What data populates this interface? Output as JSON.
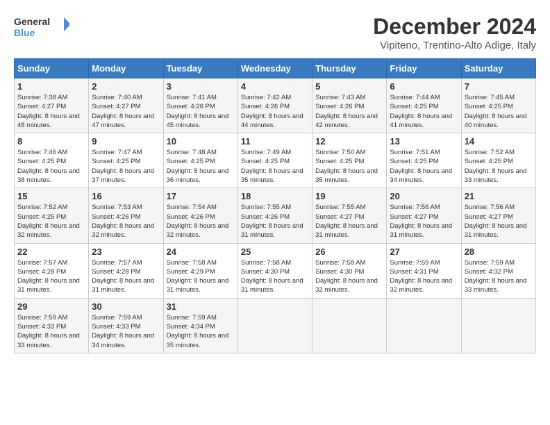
{
  "logo": {
    "line1": "General",
    "line2": "Blue"
  },
  "title": "December 2024",
  "location": "Vipiteno, Trentino-Alto Adige, Italy",
  "weekdays": [
    "Sunday",
    "Monday",
    "Tuesday",
    "Wednesday",
    "Thursday",
    "Friday",
    "Saturday"
  ],
  "weeks": [
    [
      {
        "day": "1",
        "sunrise": "7:38 AM",
        "sunset": "4:27 PM",
        "daylight": "8 hours and 48 minutes."
      },
      {
        "day": "2",
        "sunrise": "7:40 AM",
        "sunset": "4:27 PM",
        "daylight": "8 hours and 47 minutes."
      },
      {
        "day": "3",
        "sunrise": "7:41 AM",
        "sunset": "4:26 PM",
        "daylight": "8 hours and 45 minutes."
      },
      {
        "day": "4",
        "sunrise": "7:42 AM",
        "sunset": "4:26 PM",
        "daylight": "8 hours and 44 minutes."
      },
      {
        "day": "5",
        "sunrise": "7:43 AM",
        "sunset": "4:26 PM",
        "daylight": "8 hours and 42 minutes."
      },
      {
        "day": "6",
        "sunrise": "7:44 AM",
        "sunset": "4:25 PM",
        "daylight": "8 hours and 41 minutes."
      },
      {
        "day": "7",
        "sunrise": "7:45 AM",
        "sunset": "4:25 PM",
        "daylight": "8 hours and 40 minutes."
      }
    ],
    [
      {
        "day": "8",
        "sunrise": "7:46 AM",
        "sunset": "4:25 PM",
        "daylight": "8 hours and 38 minutes."
      },
      {
        "day": "9",
        "sunrise": "7:47 AM",
        "sunset": "4:25 PM",
        "daylight": "8 hours and 37 minutes."
      },
      {
        "day": "10",
        "sunrise": "7:48 AM",
        "sunset": "4:25 PM",
        "daylight": "8 hours and 36 minutes."
      },
      {
        "day": "11",
        "sunrise": "7:49 AM",
        "sunset": "4:25 PM",
        "daylight": "8 hours and 35 minutes."
      },
      {
        "day": "12",
        "sunrise": "7:50 AM",
        "sunset": "4:25 PM",
        "daylight": "8 hours and 35 minutes."
      },
      {
        "day": "13",
        "sunrise": "7:51 AM",
        "sunset": "4:25 PM",
        "daylight": "8 hours and 34 minutes."
      },
      {
        "day": "14",
        "sunrise": "7:52 AM",
        "sunset": "4:25 PM",
        "daylight": "8 hours and 33 minutes."
      }
    ],
    [
      {
        "day": "15",
        "sunrise": "7:52 AM",
        "sunset": "4:25 PM",
        "daylight": "8 hours and 32 minutes."
      },
      {
        "day": "16",
        "sunrise": "7:53 AM",
        "sunset": "4:26 PM",
        "daylight": "8 hours and 32 minutes."
      },
      {
        "day": "17",
        "sunrise": "7:54 AM",
        "sunset": "4:26 PM",
        "daylight": "8 hours and 32 minutes."
      },
      {
        "day": "18",
        "sunrise": "7:55 AM",
        "sunset": "4:26 PM",
        "daylight": "8 hours and 31 minutes."
      },
      {
        "day": "19",
        "sunrise": "7:55 AM",
        "sunset": "4:27 PM",
        "daylight": "8 hours and 31 minutes."
      },
      {
        "day": "20",
        "sunrise": "7:56 AM",
        "sunset": "4:27 PM",
        "daylight": "8 hours and 31 minutes."
      },
      {
        "day": "21",
        "sunrise": "7:56 AM",
        "sunset": "4:27 PM",
        "daylight": "8 hours and 31 minutes."
      }
    ],
    [
      {
        "day": "22",
        "sunrise": "7:57 AM",
        "sunset": "4:28 PM",
        "daylight": "8 hours and 31 minutes."
      },
      {
        "day": "23",
        "sunrise": "7:57 AM",
        "sunset": "4:28 PM",
        "daylight": "8 hours and 31 minutes."
      },
      {
        "day": "24",
        "sunrise": "7:58 AM",
        "sunset": "4:29 PM",
        "daylight": "8 hours and 31 minutes."
      },
      {
        "day": "25",
        "sunrise": "7:58 AM",
        "sunset": "4:30 PM",
        "daylight": "8 hours and 31 minutes."
      },
      {
        "day": "26",
        "sunrise": "7:58 AM",
        "sunset": "4:30 PM",
        "daylight": "8 hours and 32 minutes."
      },
      {
        "day": "27",
        "sunrise": "7:59 AM",
        "sunset": "4:31 PM",
        "daylight": "8 hours and 32 minutes."
      },
      {
        "day": "28",
        "sunrise": "7:59 AM",
        "sunset": "4:32 PM",
        "daylight": "8 hours and 33 minutes."
      }
    ],
    [
      {
        "day": "29",
        "sunrise": "7:59 AM",
        "sunset": "4:33 PM",
        "daylight": "8 hours and 33 minutes."
      },
      {
        "day": "30",
        "sunrise": "7:59 AM",
        "sunset": "4:33 PM",
        "daylight": "8 hours and 34 minutes."
      },
      {
        "day": "31",
        "sunrise": "7:59 AM",
        "sunset": "4:34 PM",
        "daylight": "8 hours and 35 minutes."
      },
      null,
      null,
      null,
      null
    ]
  ]
}
